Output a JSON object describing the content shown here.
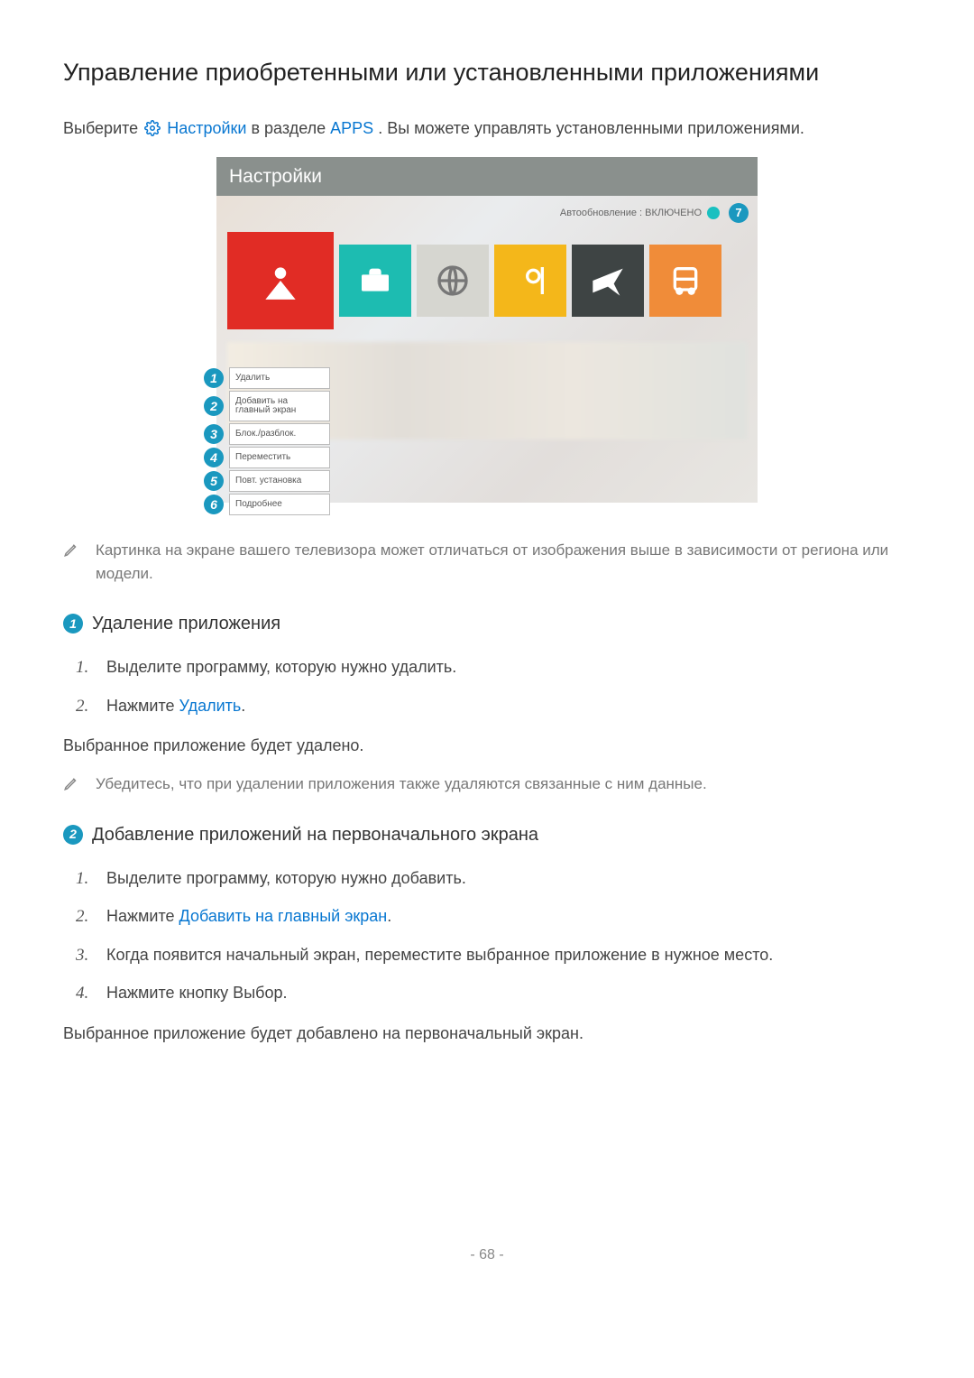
{
  "page": {
    "title": "Управление приобретенными или установленными приложениями",
    "number": "- 68 -"
  },
  "intro": {
    "prefix": "Выберите ",
    "settings_link": "Настройки",
    "mid": " в разделе ",
    "apps_link": "APPS",
    "suffix": ". Вы можете управлять установленными приложениями."
  },
  "tv": {
    "header": "Настройки",
    "auto_update": "Автообновление : ВКЛЮЧЕНО",
    "badge7": "7",
    "context_menu": [
      {
        "n": "1",
        "label": "Удалить"
      },
      {
        "n": "2",
        "label": "Добавить на главный экран"
      },
      {
        "n": "3",
        "label": "Блок./разблок."
      },
      {
        "n": "4",
        "label": "Переместить"
      },
      {
        "n": "5",
        "label": "Повт. установка"
      },
      {
        "n": "6",
        "label": "Подробнее"
      }
    ]
  },
  "note1": "Картинка на экране вашего телевизора может отличаться от изображения выше в зависимости от региона или модели.",
  "section1": {
    "badge": "1",
    "title": "Удаление приложения",
    "steps": [
      {
        "n": "1.",
        "text": "Выделите программу, которую нужно удалить."
      },
      {
        "n": "2.",
        "prefix": "Нажмите ",
        "link": "Удалить",
        "suffix": "."
      }
    ],
    "result": "Выбранное приложение будет удалено.",
    "note": "Убедитесь, что при удалении приложения также удаляются связанные с ним данные."
  },
  "section2": {
    "badge": "2",
    "title": "Добавление приложений на первоначального экрана",
    "steps": [
      {
        "n": "1.",
        "text": "Выделите программу, которую нужно добавить."
      },
      {
        "n": "2.",
        "prefix": "Нажмите ",
        "link": "Добавить на главный экран",
        "suffix": "."
      },
      {
        "n": "3.",
        "text": "Когда появится начальный экран, переместите выбранное приложение в нужное место."
      },
      {
        "n": "4.",
        "text": "Нажмите кнопку Выбор."
      }
    ],
    "result": "Выбранное приложение будет добавлено на первоначальный экран."
  }
}
